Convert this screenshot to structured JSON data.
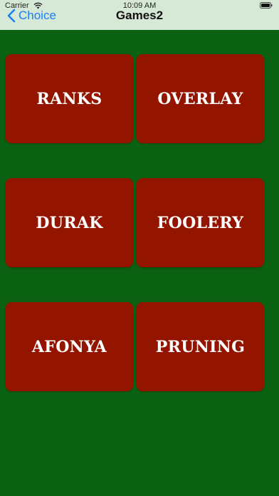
{
  "status_bar": {
    "carrier": "Carrier",
    "time": "10:09 AM",
    "wifi_icon": "wifi-icon",
    "battery_icon": "battery-icon"
  },
  "nav": {
    "back_label": "Choice",
    "back_icon": "chevron-left-icon",
    "title": "Games2"
  },
  "colors": {
    "background": "#0b6112",
    "navbar": "#d6e8d6",
    "tile": "#931500",
    "tile_text": "#ffffff",
    "accent": "#1a7ff7"
  },
  "games": [
    {
      "label": "RANKS"
    },
    {
      "label": "OVERLAY"
    },
    {
      "label": "DURAK"
    },
    {
      "label": "FOOLERY"
    },
    {
      "label": "AFONYA"
    },
    {
      "label": "PRUNING"
    }
  ]
}
